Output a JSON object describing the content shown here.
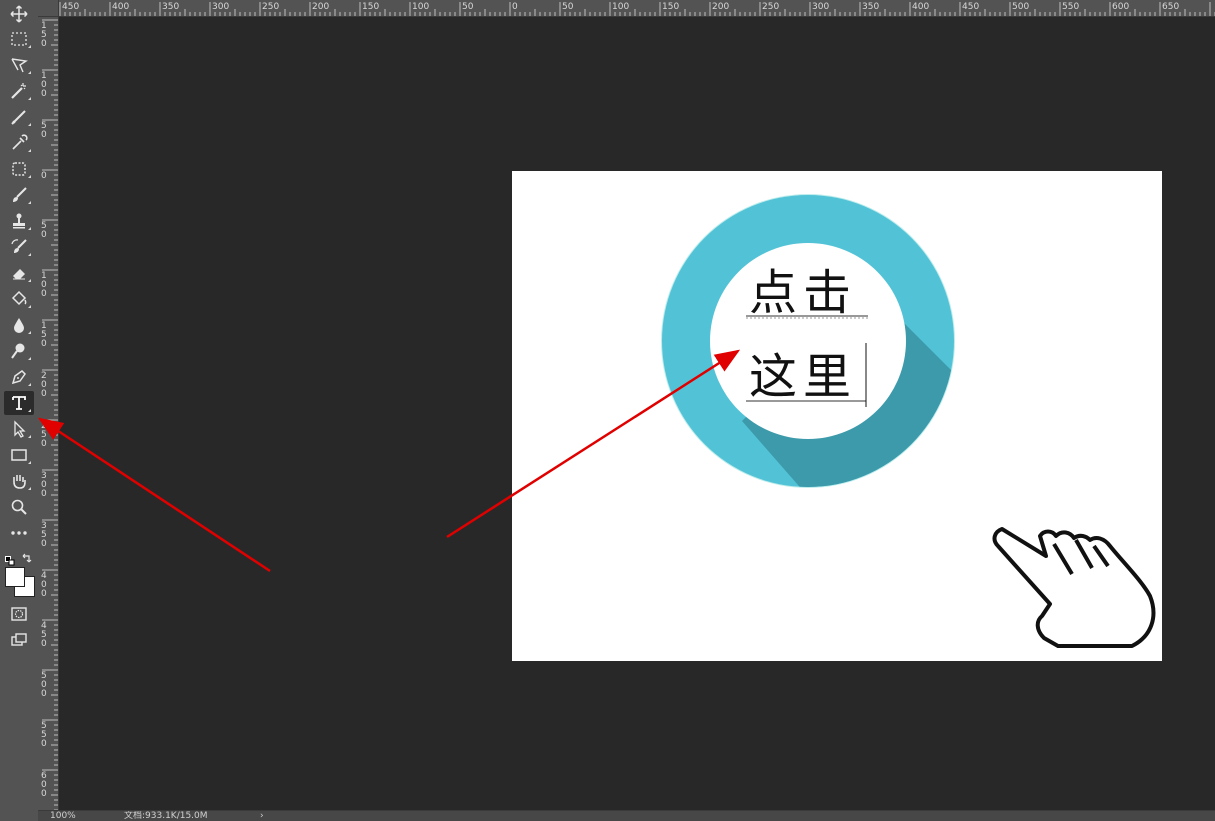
{
  "toolbar": {
    "tools": [
      {
        "name": "move-tool",
        "icon": "move-icon"
      },
      {
        "name": "marquee-tool",
        "icon": "marquee-icon"
      },
      {
        "name": "lasso-tool",
        "icon": "lasso-icon"
      },
      {
        "name": "magic-wand-tool",
        "icon": "magic-wand-icon"
      },
      {
        "name": "crop-tool",
        "icon": "crop-icon"
      },
      {
        "name": "eyedropper-tool",
        "icon": "eyedropper-icon"
      },
      {
        "name": "patch-tool",
        "icon": "patch-icon"
      },
      {
        "name": "brush-tool",
        "icon": "brush-icon"
      },
      {
        "name": "stamp-tool",
        "icon": "stamp-icon"
      },
      {
        "name": "history-brush-tool",
        "icon": "history-brush-icon"
      },
      {
        "name": "eraser-tool",
        "icon": "eraser-icon"
      },
      {
        "name": "paint-bucket-tool",
        "icon": "paint-bucket-icon"
      },
      {
        "name": "blur-tool",
        "icon": "blur-icon"
      },
      {
        "name": "dodge-tool",
        "icon": "dodge-icon"
      },
      {
        "name": "pen-tool",
        "icon": "pen-icon"
      },
      {
        "name": "type-tool",
        "icon": "type-icon",
        "active": true
      },
      {
        "name": "path-selection-tool",
        "icon": "arrow-icon"
      },
      {
        "name": "rectangle-tool",
        "icon": "rectangle-icon"
      },
      {
        "name": "hand-tool",
        "icon": "hand-icon"
      },
      {
        "name": "zoom-tool",
        "icon": "zoom-icon"
      },
      {
        "name": "more-tools",
        "icon": "more-icon"
      }
    ],
    "foreground_color": "#ffffff",
    "background_color": "#ffffff"
  },
  "rulers": {
    "top_labels": [
      "450",
      "400",
      "350",
      "300",
      "250",
      "200",
      "150",
      "100",
      "50",
      "0",
      "50",
      "100",
      "150",
      "200",
      "250",
      "300",
      "350",
      "400",
      "450",
      "500",
      "550",
      "600",
      "650"
    ],
    "left_labels": [
      "1 5 0",
      "1 0 0",
      "5 0",
      "0",
      "5 0",
      "1 0 0",
      "1 5 0",
      "2 0 0",
      "2 5 0",
      "3 0 0",
      "3 5 0",
      "4 0 0",
      "4 5 0",
      "5 0 0",
      "5 5 0",
      "6 0 0"
    ]
  },
  "document": {
    "text_line1": "点击",
    "text_line2": "这里",
    "ring_color": "#52c3d6",
    "shadow_color": "#3c9aab"
  },
  "annotations": {
    "arrow_color": "#e00000"
  },
  "status": {
    "zoom": "100%",
    "doc_info": "文档:933.1K/15.0M"
  }
}
